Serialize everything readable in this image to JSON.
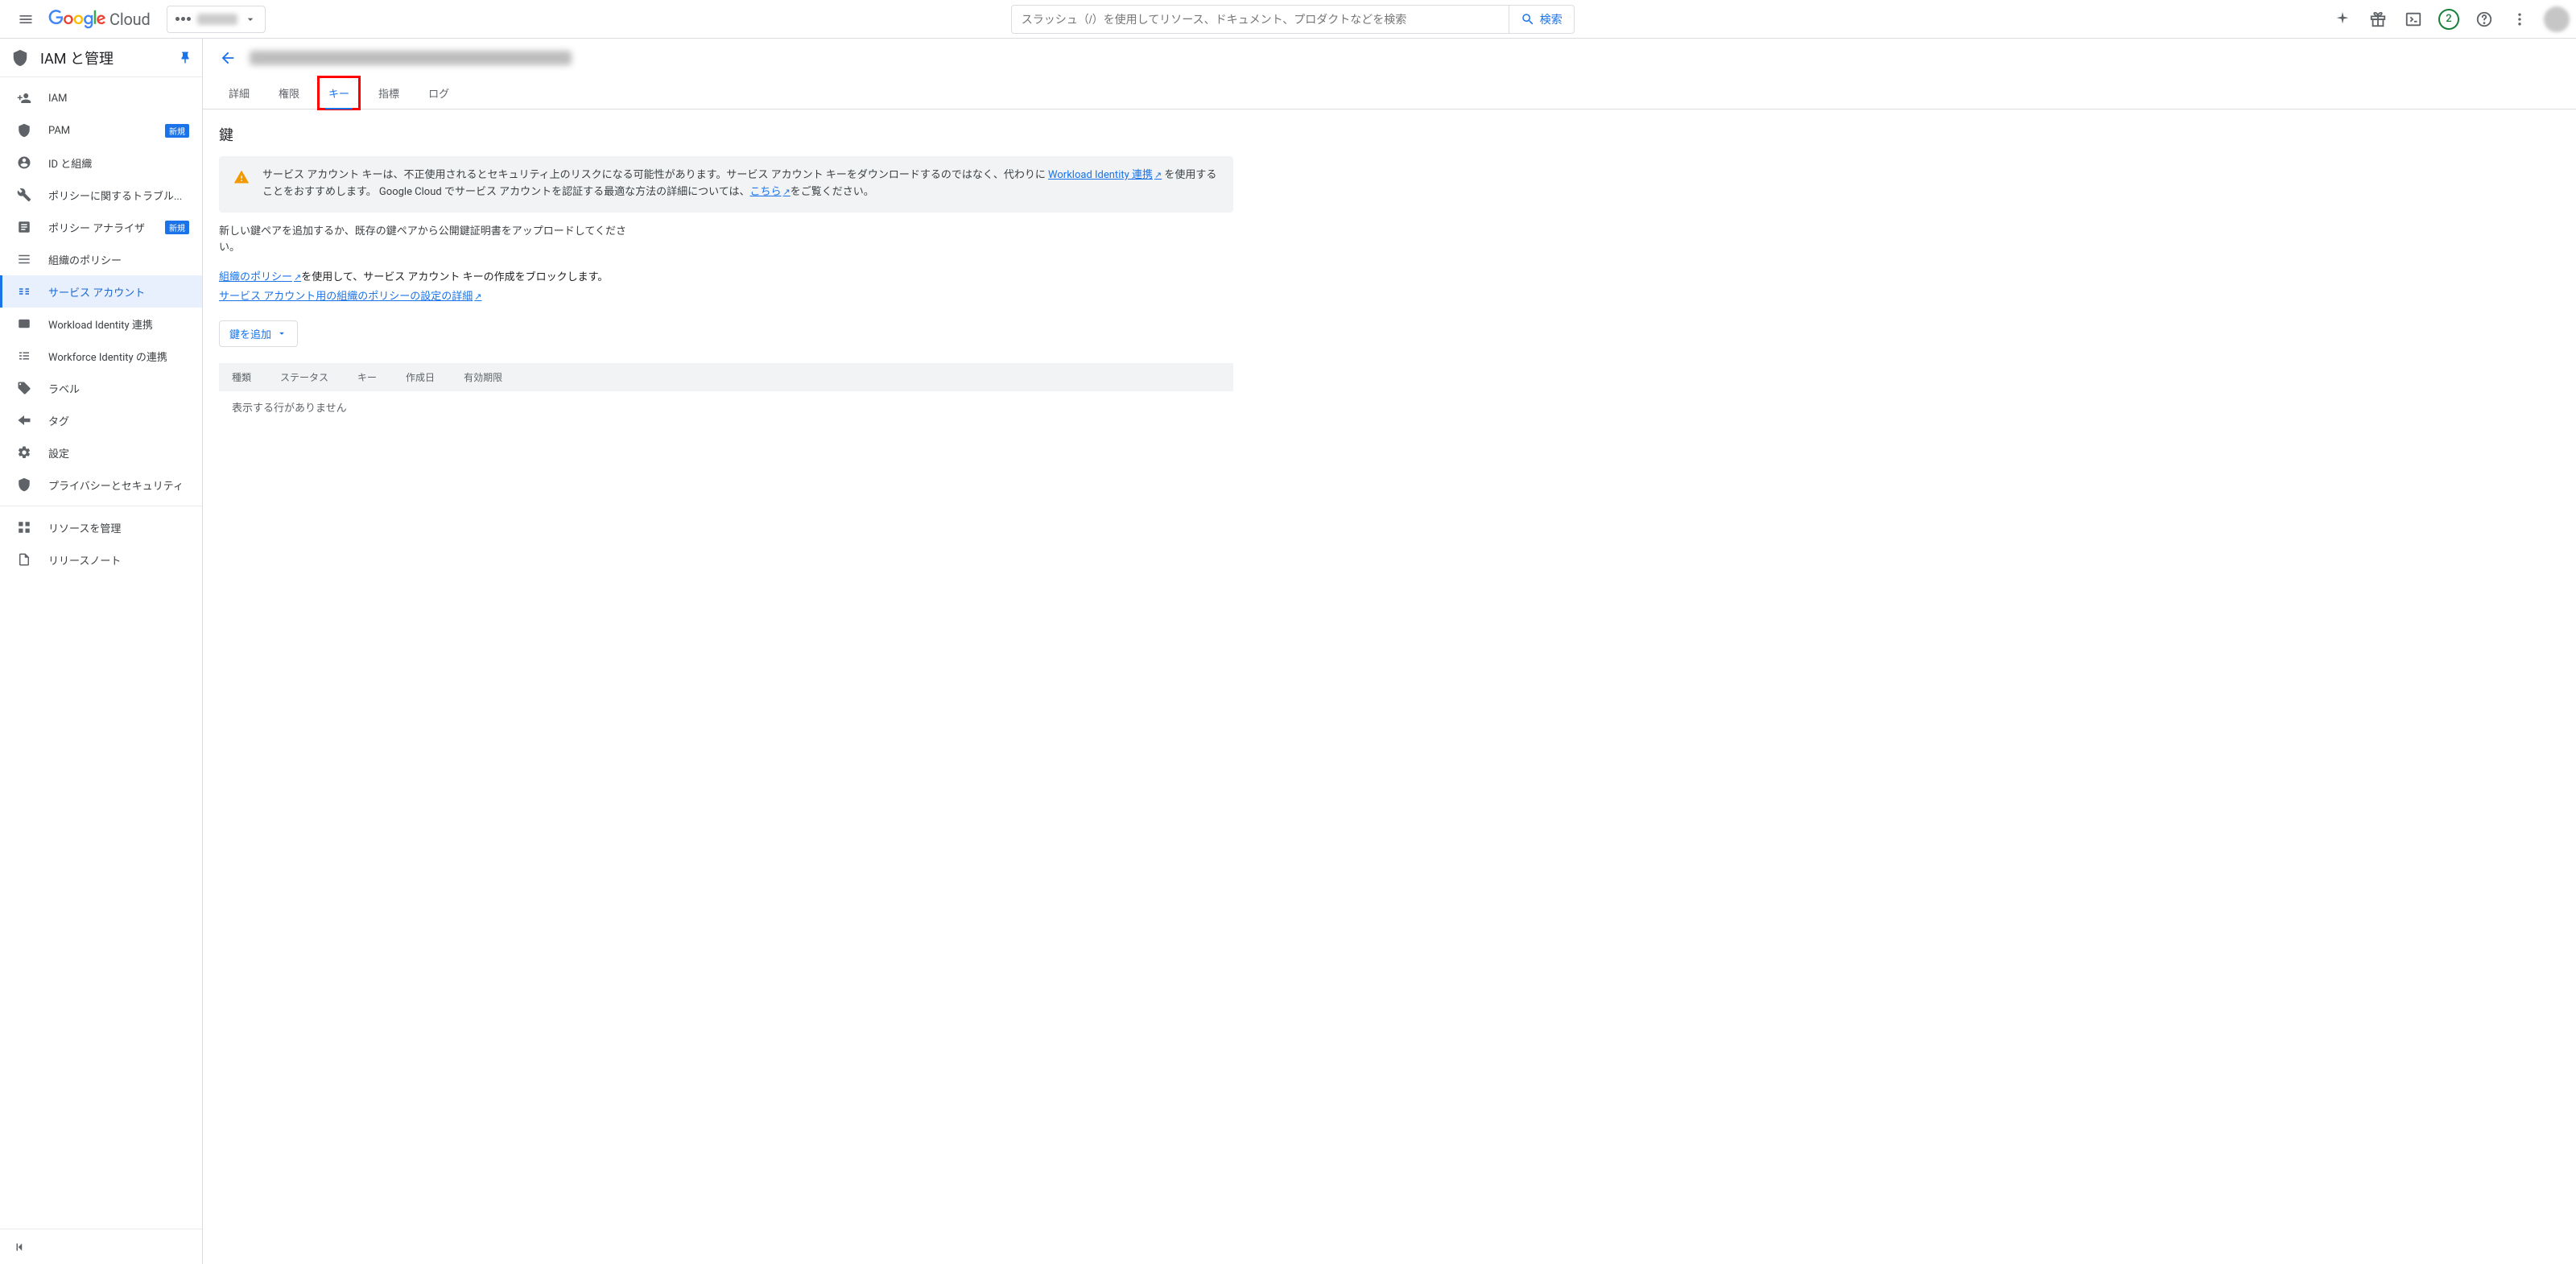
{
  "topbar": {
    "logo_cloud_text": "Cloud",
    "search_placeholder": "スラッシュ（/）を使用してリソース、ドキュメント、プロダクトなどを検索",
    "search_button": "検索",
    "trial_count": "2"
  },
  "sidebar": {
    "section_title": "IAM と管理",
    "items": [
      {
        "label": "IAM"
      },
      {
        "label": "PAM",
        "new": "新規"
      },
      {
        "label": "ID と組織"
      },
      {
        "label": "ポリシーに関するトラブル..."
      },
      {
        "label": "ポリシー アナライザ",
        "new": "新規"
      },
      {
        "label": "組織のポリシー"
      },
      {
        "label": "サービス アカウント"
      },
      {
        "label": "Workload Identity 連携"
      },
      {
        "label": "Workforce Identity の連携"
      },
      {
        "label": "ラベル"
      },
      {
        "label": "タグ"
      },
      {
        "label": "設定"
      },
      {
        "label": "プライバシーとセキュリティ"
      }
    ],
    "footer": [
      {
        "label": "リソースを管理"
      },
      {
        "label": "リリースノート"
      }
    ]
  },
  "tabs": [
    {
      "label": "詳細"
    },
    {
      "label": "権限"
    },
    {
      "label": "キー"
    },
    {
      "label": "指標"
    },
    {
      "label": "ログ"
    }
  ],
  "content": {
    "heading": "鍵",
    "warning_pre": "サービス アカウント キーは、不正使用されるとセキュリティ上のリスクになる可能性があります。サービス アカウント キーをダウンロードするのではなく、代わりに ",
    "warning_link1": "Workload Identity 連携",
    "warning_mid": " を使用することをおすすめします。 Google Cloud でサービス アカウントを認証する最適な方法の詳細については、",
    "warning_link2": "こちら",
    "warning_post": "をご覧ください。",
    "para1": "新しい鍵ペアを追加するか、既存の鍵ペアから公開鍵証明書をアップロードしてください。",
    "links_link1": "組織のポリシー",
    "links_text1": "を使用して、サービス アカウント キーの作成をブロックします。",
    "links_link2": "サービス アカウント用の組織のポリシーの設定の詳細",
    "add_key_button": "鍵を追加",
    "table_headers": [
      "種類",
      "ステータス",
      "キー",
      "作成日",
      "有効期限"
    ],
    "table_empty": "表示する行がありません"
  }
}
